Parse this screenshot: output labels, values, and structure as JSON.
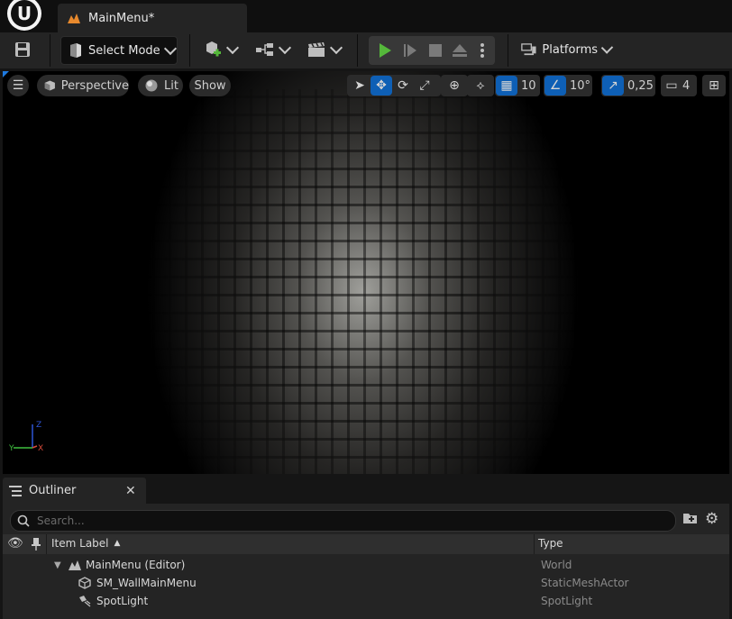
{
  "tab": {
    "title": "MainMenu*"
  },
  "toolbar": {
    "select_mode": "Select Mode",
    "platforms": "Platforms"
  },
  "viewport": {
    "perspective": "Perspective",
    "lit": "Lit",
    "show": "Show",
    "grid_snap": "10",
    "rotation_snap": "10°",
    "scale_snap": "0,25",
    "camera_speed": "4",
    "axis_x": "X",
    "axis_y": "Y",
    "axis_z": "Z"
  },
  "outliner": {
    "tab_label": "Outliner",
    "search_placeholder": "Search...",
    "columns": {
      "label": "Item Label",
      "type": "Type"
    },
    "rows": [
      {
        "label": "MainMenu (Editor)",
        "type": "World",
        "icon": "world-icon"
      },
      {
        "label": "SM_WallMainMenu",
        "type": "StaticMeshActor",
        "icon": "static-mesh-icon"
      },
      {
        "label": "SpotLight",
        "type": "SpotLight",
        "icon": "spotlight-icon"
      }
    ]
  },
  "colors": {
    "accent_blue": "#0e5fb5",
    "play_green": "#55b83b",
    "level_orange": "#e8892d"
  }
}
